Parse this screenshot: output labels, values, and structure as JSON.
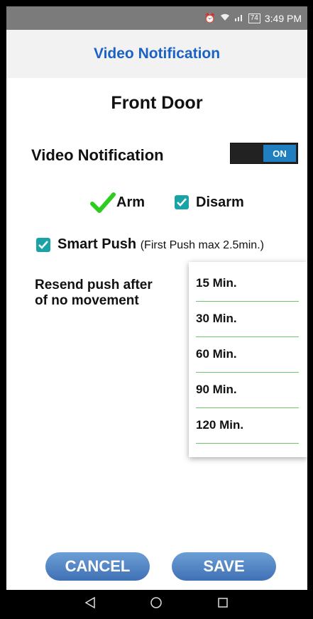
{
  "status_bar": {
    "alarm_icon": "alarm-clock-icon",
    "wifi_icon": "wifi-icon",
    "signal_icon": "signal-bars-icon",
    "battery": "74",
    "time": "3:49 PM"
  },
  "header": {
    "title": "Video Notification"
  },
  "device": {
    "name": "Front Door"
  },
  "video_notification": {
    "label": "Video Notification",
    "toggle_state": "ON"
  },
  "mode": {
    "arm_label": "Arm",
    "disarm_label": "Disarm",
    "arm_checked": true,
    "disarm_checked": true
  },
  "smart_push": {
    "label": "Smart Push",
    "note": "(First Push max 2.5min.)",
    "checked": true
  },
  "resend": {
    "label_line1": "Resend push after",
    "label_line2": "of no movement"
  },
  "resend_options": [
    "15 Min.",
    "30 Min.",
    "60 Min.",
    "90 Min.",
    "120 Min."
  ],
  "buttons": {
    "cancel": "CANCEL",
    "save": "SAVE"
  },
  "nav": {
    "back_icon": "back-triangle-icon",
    "home_icon": "home-circle-icon",
    "recents_icon": "recents-square-icon"
  },
  "colors": {
    "accent_blue": "#1a62c4",
    "toggle_on": "#1f7fc0",
    "checkbox": "#1aa3a6",
    "arm_check": "#2ecc1e",
    "button": "#4a7cc0"
  }
}
